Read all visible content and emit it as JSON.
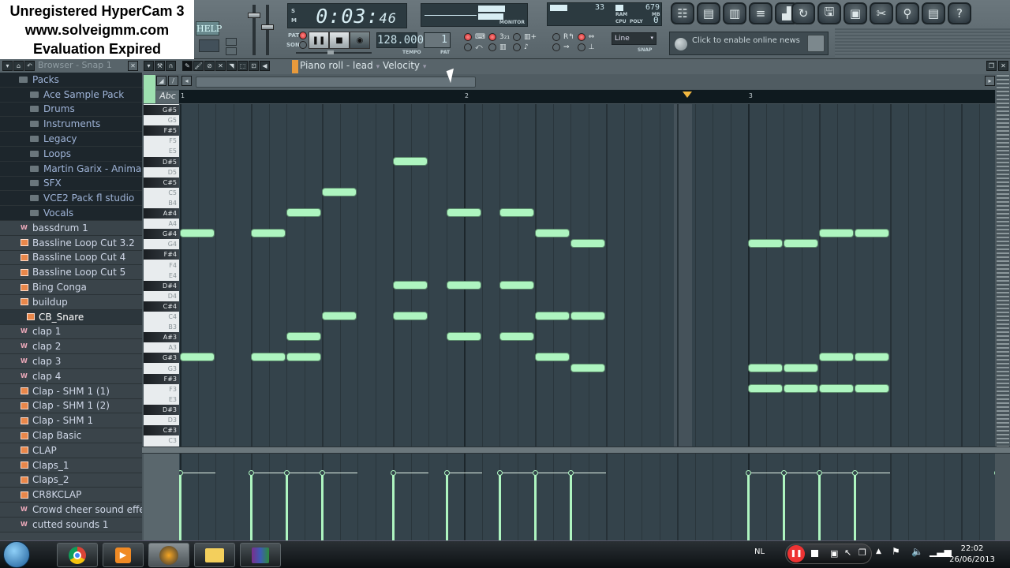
{
  "watermark": {
    "line1": "Unregistered HyperCam 3",
    "line2": "www.solveigmm.com",
    "line3": "Evaluation Expired"
  },
  "toolbar": {
    "help_label": "HELP",
    "time_main": "0:03:",
    "time_sub": "46",
    "monitor_label": "MONITOR",
    "cpu_value": "33",
    "ram_value": "679",
    "ram_unit": "MB",
    "poly_value": "0",
    "cpu_label": "CPU",
    "ram_label": "RAM",
    "poly_label": "POLY",
    "pat_label": "PAT",
    "song_label": "SONG",
    "tempo_value": "128.000",
    "tempo_label": "TEMPO",
    "pattern_value": "1",
    "pattern_label": "PAT",
    "snap_value": "Line",
    "snap_label": "SNAP",
    "news_text": "Click to enable online news"
  },
  "browser": {
    "title": "Browser - Snap 1",
    "items": [
      {
        "label": "Packs",
        "type": "folder",
        "indent": 0
      },
      {
        "label": "Ace Sample Pack",
        "type": "folder",
        "indent": 1
      },
      {
        "label": "Drums",
        "type": "folder",
        "indent": 1
      },
      {
        "label": "Instruments",
        "type": "folder",
        "indent": 1
      },
      {
        "label": "Legacy",
        "type": "folder",
        "indent": 1
      },
      {
        "label": "Loops",
        "type": "folder",
        "indent": 1
      },
      {
        "label": "Martin Garix - Animals",
        "type": "folder",
        "indent": 1
      },
      {
        "label": "SFX",
        "type": "folder",
        "indent": 1
      },
      {
        "label": "VCE2 Pack fl studio",
        "type": "folder",
        "indent": 1
      },
      {
        "label": "Vocals",
        "type": "folder",
        "indent": 1
      },
      {
        "label": "bassdrum 1",
        "type": "wave"
      },
      {
        "label": "Bassline Loop Cut 3.2",
        "type": "audio"
      },
      {
        "label": "Bassline Loop Cut 4",
        "type": "audio"
      },
      {
        "label": "Bassline Loop Cut 5",
        "type": "audio"
      },
      {
        "label": "Bing Conga",
        "type": "audio"
      },
      {
        "label": "buildup",
        "type": "audio"
      },
      {
        "label": "CB_Snare",
        "type": "audio",
        "selected": true
      },
      {
        "label": "clap 1",
        "type": "wave"
      },
      {
        "label": "clap 2",
        "type": "wave"
      },
      {
        "label": "clap 3",
        "type": "wave"
      },
      {
        "label": "clap 4",
        "type": "wave"
      },
      {
        "label": "Clap - SHM 1 (1)",
        "type": "audio"
      },
      {
        "label": "Clap - SHM 1 (2)",
        "type": "audio"
      },
      {
        "label": "Clap - SHM 1",
        "type": "audio"
      },
      {
        "label": "Clap Basic",
        "type": "audio"
      },
      {
        "label": "CLAP",
        "type": "audio"
      },
      {
        "label": "Claps_1",
        "type": "audio"
      },
      {
        "label": "Claps_2",
        "type": "audio"
      },
      {
        "label": "CR8KCLAP",
        "type": "audio"
      },
      {
        "label": "Crowd cheer sound effect",
        "type": "wave"
      },
      {
        "label": "cutted sounds 1",
        "type": "wave"
      }
    ]
  },
  "piano_roll": {
    "title": "Piano roll - lead",
    "target": "Velocity",
    "ruler_bars": [
      "1",
      "2",
      "3"
    ],
    "abc_label": "Abc",
    "note_color": "#aef5c0",
    "keys": [
      "G#5",
      "G5",
      "F#5",
      "F5",
      "E5",
      "D#5",
      "D5",
      "C#5",
      "C5",
      "B4",
      "A#4",
      "A4",
      "G#4",
      "G4",
      "F#4",
      "F4",
      "E4",
      "D#4",
      "D4",
      "C#4",
      "C4",
      "B3",
      "A#3",
      "A3",
      "G#3",
      "G3",
      "F#3",
      "F3",
      "E3",
      "D#3",
      "D3",
      "C#3",
      "C3"
    ],
    "notes": [
      {
        "step": 0,
        "len": 2,
        "pitch": "G#4"
      },
      {
        "step": 0,
        "len": 2,
        "pitch": "G#3"
      },
      {
        "step": 4,
        "len": 2,
        "pitch": "G#4"
      },
      {
        "step": 4,
        "len": 2,
        "pitch": "G#3"
      },
      {
        "step": 6,
        "len": 2,
        "pitch": "A#4"
      },
      {
        "step": 6,
        "len": 2,
        "pitch": "A#3"
      },
      {
        "step": 6,
        "len": 2,
        "pitch": "G#3"
      },
      {
        "step": 8,
        "len": 2,
        "pitch": "C5"
      },
      {
        "step": 8,
        "len": 2,
        "pitch": "C4"
      },
      {
        "step": 12,
        "len": 2,
        "pitch": "D#5"
      },
      {
        "step": 12,
        "len": 2,
        "pitch": "D#4"
      },
      {
        "step": 12,
        "len": 2,
        "pitch": "C4"
      },
      {
        "step": 15,
        "len": 2,
        "pitch": "A#4"
      },
      {
        "step": 15,
        "len": 2,
        "pitch": "D#4"
      },
      {
        "step": 15,
        "len": 2,
        "pitch": "A#3"
      },
      {
        "step": 18,
        "len": 2,
        "pitch": "A#4"
      },
      {
        "step": 18,
        "len": 2,
        "pitch": "D#4"
      },
      {
        "step": 18,
        "len": 2,
        "pitch": "A#3"
      },
      {
        "step": 20,
        "len": 2,
        "pitch": "G#4"
      },
      {
        "step": 20,
        "len": 2,
        "pitch": "C4"
      },
      {
        "step": 20,
        "len": 2,
        "pitch": "G#3"
      },
      {
        "step": 22,
        "len": 2,
        "pitch": "G4"
      },
      {
        "step": 22,
        "len": 2,
        "pitch": "C4"
      },
      {
        "step": 22,
        "len": 2,
        "pitch": "G3"
      },
      {
        "step": 32,
        "len": 2,
        "pitch": "G4"
      },
      {
        "step": 32,
        "len": 2,
        "pitch": "G3"
      },
      {
        "step": 32,
        "len": 2,
        "pitch": "F3"
      },
      {
        "step": 34,
        "len": 2,
        "pitch": "G4"
      },
      {
        "step": 34,
        "len": 2,
        "pitch": "G3"
      },
      {
        "step": 34,
        "len": 2,
        "pitch": "F3"
      },
      {
        "step": 36,
        "len": 2,
        "pitch": "G#4"
      },
      {
        "step": 36,
        "len": 2,
        "pitch": "G#3"
      },
      {
        "step": 36,
        "len": 2,
        "pitch": "F3"
      },
      {
        "step": 38,
        "len": 2,
        "pitch": "G#4"
      },
      {
        "step": 38,
        "len": 2,
        "pitch": "G#3"
      },
      {
        "step": 38,
        "len": 2,
        "pitch": "F3"
      }
    ],
    "velocity_steps": [
      0,
      4,
      6,
      8,
      12,
      15,
      18,
      20,
      22,
      32,
      34,
      36,
      38,
      46
    ],
    "velocity_level": 0.78
  },
  "taskbar": {
    "language": "NL",
    "time": "22:02",
    "date": "26/06/2013",
    "apps": [
      "windows-start",
      "chrome",
      "media-player",
      "fl-studio",
      "explorer",
      "winrar"
    ]
  }
}
